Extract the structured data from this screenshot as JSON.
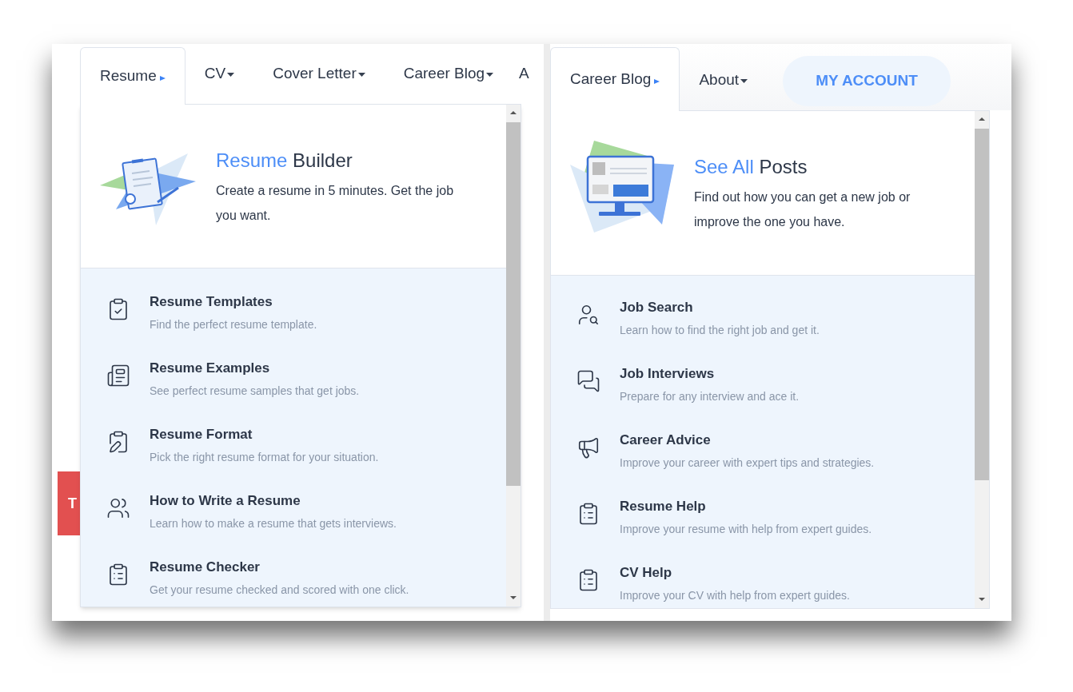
{
  "left_panel": {
    "nav": [
      {
        "label": "Resume",
        "selected": true
      },
      {
        "label": "CV",
        "selected": false
      },
      {
        "label": "Cover Letter",
        "selected": false
      },
      {
        "label": "Career Blog",
        "selected": false
      },
      {
        "label": "A",
        "kind": "cut"
      }
    ],
    "hero": {
      "title_accent": "Resume",
      "title_rest": "Builder",
      "description": "Create a resume in 5 minutes. Get the job you want."
    },
    "items": [
      {
        "title": "Resume Templates",
        "description": "Find the perfect resume template."
      },
      {
        "title": "Resume Examples",
        "description": "See perfect resume samples that get jobs."
      },
      {
        "title": "Resume Format",
        "description": "Pick the right resume format for your situation."
      },
      {
        "title": "How to Write a Resume",
        "description": "Learn how to make a resume that gets interviews."
      },
      {
        "title": "Resume Checker",
        "description": "Get your resume checked and scored with one click."
      }
    ],
    "background_button": "T"
  },
  "right_panel": {
    "nav": [
      {
        "label": "Career Blog",
        "selected": true
      },
      {
        "label": "About",
        "selected": false
      }
    ],
    "account_button": "MY ACCOUNT",
    "hero": {
      "title_accent": "See All",
      "title_rest": "Posts",
      "description": "Find out how you can get a new job or improve the one you have."
    },
    "items": [
      {
        "title": "Job Search",
        "description": "Learn how to find the right job and get it."
      },
      {
        "title": "Job Interviews",
        "description": "Prepare for any interview and ace it."
      },
      {
        "title": "Career Advice",
        "description": "Improve your career with expert tips and strategies."
      },
      {
        "title": "Resume Help",
        "description": "Improve your resume with help from expert guides."
      },
      {
        "title": "CV Help",
        "description": "Improve your CV with help from expert guides."
      }
    ]
  }
}
